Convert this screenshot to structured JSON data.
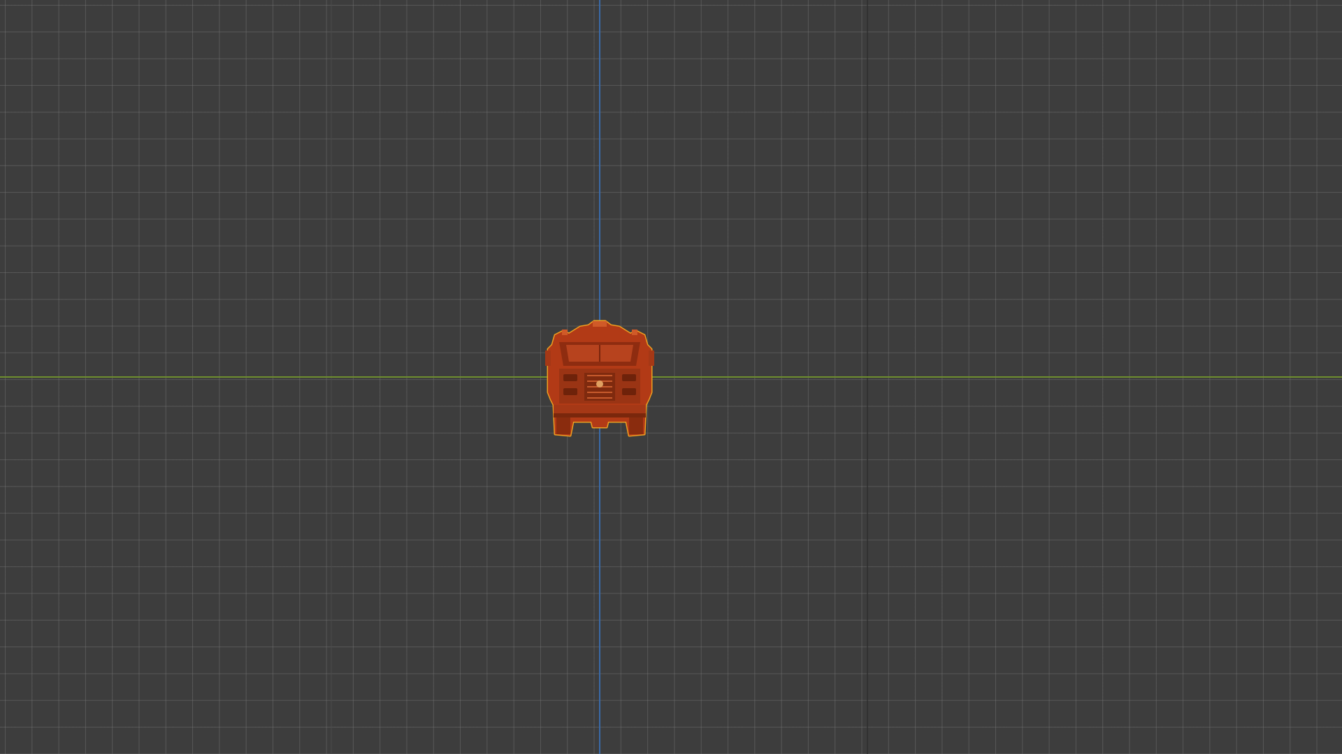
{
  "viewport": {
    "background_color": "#3d3d3d",
    "grid_color": "#7a7a7a",
    "x_axis_color": "#6f8e2e",
    "y_axis_color": "#3a6aa8"
  },
  "selected_object": {
    "icon": "vehicle-model-icon",
    "body_color": "#b23a16",
    "outline_color": "#f0a020"
  }
}
